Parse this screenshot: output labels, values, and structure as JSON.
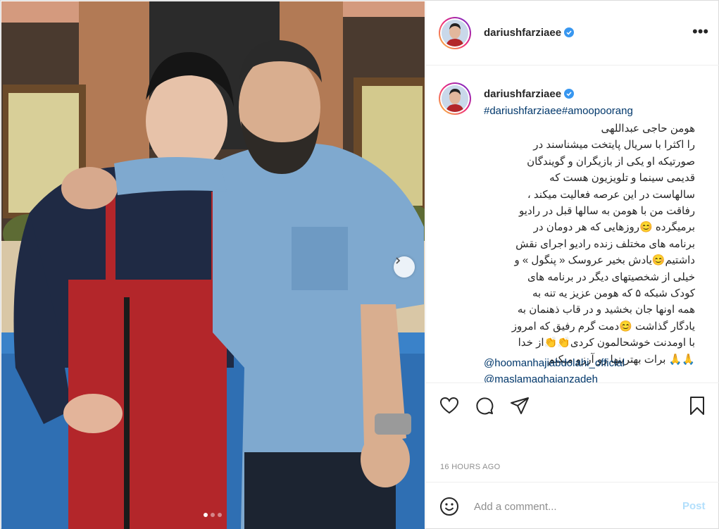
{
  "post": {
    "username": "dariushfarziaee",
    "hashtags": "#dariushfarziaee#amoopoorang",
    "caption_lines": [
      "هومن حاجی عبداللهی",
      "را اکثرا با سریال پایتخت میشناسند در",
      "صورتیکه او یکی از بازیگران و گویندگان",
      "قدیمی سینما و تلویزیون هست که",
      "سالهاست در این عرصه فعالیت میکند ،",
      "رفاقت من با هومن به سالها قبل در رادیو",
      "برمیگرده 😊روزهایی که هر دومان در",
      "برنامه های مختلف زنده رادیو اجرای نقش",
      "داشتیم😊یادش بخیر عروسک « پنگول » و",
      "خیلی از شخصیتهای دیگر در برنامه های",
      "کودک شبکه ۵ که هومن عزیز یه تنه به",
      "همه اونها جان بخشید و در قاب ذهنمان به",
      "یادگار گذاشت 😊دمت گرم رفیق که امروز",
      "با اومدنت خوشحالمون کردی👏👏از خدا",
      "🙏🙏 برات بهترینها رو آرزو میکنم"
    ],
    "mentions": [
      "@hoomanhajiabdolahi_official",
      "@maslamaghaianzadeh"
    ],
    "timestamp": "16 HOURS AGO"
  },
  "comment_box": {
    "placeholder": "Add a comment...",
    "post_label": "Post"
  },
  "carousel": {
    "total": 3,
    "active": 1
  },
  "colors": {
    "link": "#00376b",
    "text": "#262626",
    "muted": "#8e8e8e",
    "verified": "#3897f0",
    "post_disabled": "#b2dffc"
  }
}
